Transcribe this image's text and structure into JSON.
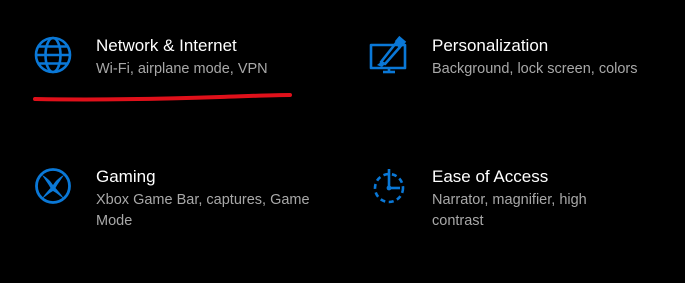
{
  "settings_tiles": [
    {
      "id": "network",
      "title": "Network & Internet",
      "description": "Wi-Fi, airplane mode, VPN",
      "icon": "globe-icon"
    },
    {
      "id": "personalization",
      "title": "Personalization",
      "description": "Background, lock screen, colors",
      "icon": "personalization-icon"
    },
    {
      "id": "gaming",
      "title": "Gaming",
      "description": "Xbox Game Bar, captures, Game Mode",
      "icon": "xbox-icon"
    },
    {
      "id": "ease_of_access",
      "title": "Ease of Access",
      "description": "Narrator, magnifier, high contrast",
      "icon": "ease-of-access-icon"
    }
  ],
  "colors": {
    "accent": "#0a78d7",
    "background": "#000000",
    "title_text": "#ffffff",
    "description_text": "#a8a8a8",
    "annotation_stroke": "#e0101a"
  }
}
